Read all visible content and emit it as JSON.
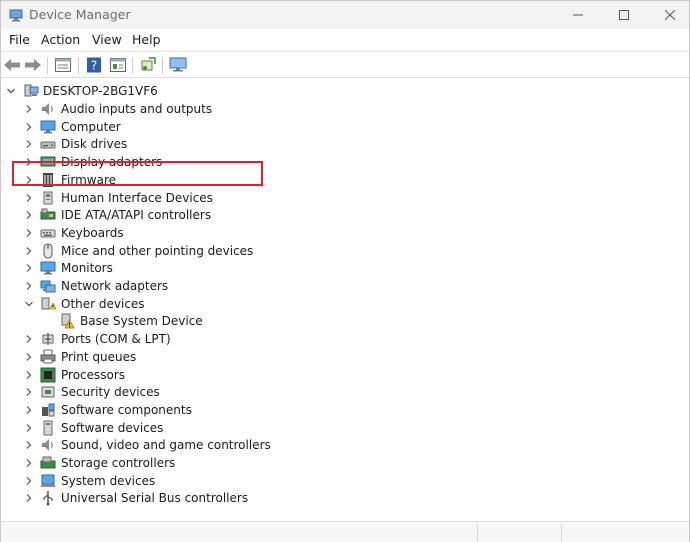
{
  "window": {
    "title": "Device Manager"
  },
  "menu": [
    "File",
    "Action",
    "View",
    "Help"
  ],
  "tree": {
    "root": "DESKTOP-2BG1VF6",
    "items": [
      {
        "label": "Audio inputs and outputs",
        "icon": "speaker-icon"
      },
      {
        "label": "Computer",
        "icon": "monitor-icon"
      },
      {
        "label": "Disk drives",
        "icon": "disk-drive-icon"
      },
      {
        "label": "Display adapters",
        "icon": "display-adapter-icon"
      },
      {
        "label": "Firmware",
        "icon": "firmware-icon"
      },
      {
        "label": "Human Interface Devices",
        "icon": "hid-icon"
      },
      {
        "label": "IDE ATA/ATAPI controllers",
        "icon": "ide-controller-icon"
      },
      {
        "label": "Keyboards",
        "icon": "keyboard-icon"
      },
      {
        "label": "Mice and other pointing devices",
        "icon": "mouse-icon"
      },
      {
        "label": "Monitors",
        "icon": "monitor-icon"
      },
      {
        "label": "Network adapters",
        "icon": "network-adapter-icon"
      },
      {
        "label": "Other devices",
        "icon": "other-devices-icon",
        "expanded": true,
        "children": [
          {
            "label": "Base System Device",
            "icon": "warning-device-icon"
          }
        ]
      },
      {
        "label": "Ports (COM & LPT)",
        "icon": "port-icon"
      },
      {
        "label": "Print queues",
        "icon": "printer-icon"
      },
      {
        "label": "Processors",
        "icon": "processor-icon"
      },
      {
        "label": "Security devices",
        "icon": "security-device-icon"
      },
      {
        "label": "Software components",
        "icon": "software-component-icon"
      },
      {
        "label": "Software devices",
        "icon": "software-device-icon"
      },
      {
        "label": "Sound, video and game controllers",
        "icon": "speaker-icon"
      },
      {
        "label": "Storage controllers",
        "icon": "storage-controller-icon"
      },
      {
        "label": "System devices",
        "icon": "system-device-icon"
      },
      {
        "label": "Universal Serial Bus controllers",
        "icon": "usb-icon"
      }
    ]
  },
  "colors": {
    "highlight": "#e0202a",
    "titlebar": "#f3f3f3"
  }
}
